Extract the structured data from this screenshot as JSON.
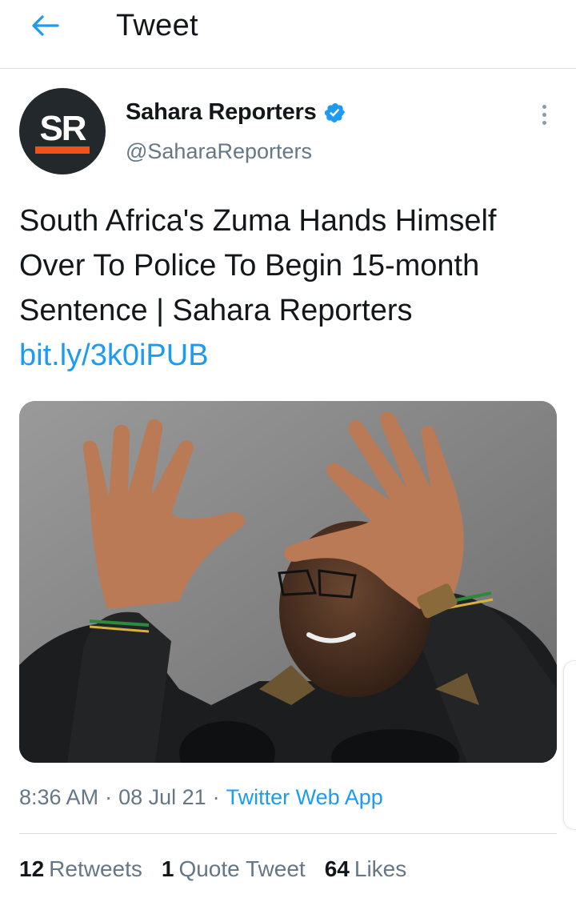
{
  "header": {
    "title": "Tweet",
    "back_icon": "arrow-left-icon"
  },
  "author": {
    "name": "Sahara Reporters",
    "handle": "@SaharaReporters",
    "avatar_text": "SR",
    "verified": true,
    "avatar_bg": "#23282c",
    "avatar_accent": "#f1511b"
  },
  "tweet": {
    "text": "South Africa's Zuma Hands Himself Over To Police To Begin 15-month Sentence | Sahara Reporters ",
    "link": "bit.ly/3k0iPUB"
  },
  "meta": {
    "time": "8:36 AM",
    "sep": "·",
    "date": "08 Jul 21",
    "source": "Twitter Web App"
  },
  "stats": {
    "retweets_count": "12",
    "retweets_label": "Retweets",
    "quotes_count": "1",
    "quotes_label": "Quote Tweet",
    "likes_count": "64",
    "likes_label": "Likes"
  },
  "colors": {
    "accent": "#1d9bf0",
    "secondary_text": "#657786",
    "verified": "#1d9bf0"
  }
}
